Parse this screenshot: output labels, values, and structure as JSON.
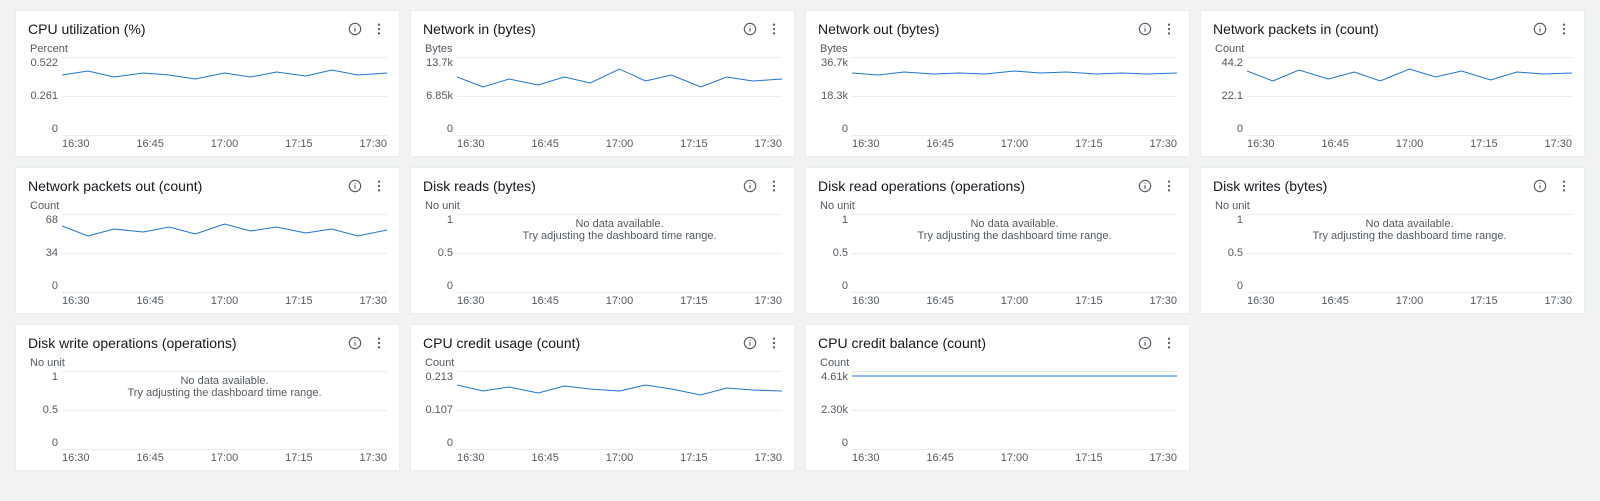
{
  "xTicks": [
    "16:30",
    "16:45",
    "17:00",
    "17:15",
    "17:30"
  ],
  "noData": {
    "line1": "No data available.",
    "line2": "Try adjusting the dashboard time range."
  },
  "lineColor": "#2074d5",
  "widgets": [
    {
      "title": "CPU utilization (%)",
      "unit": "Percent",
      "yTicks": [
        "0.522",
        "0.261",
        "0"
      ],
      "series": "wavy",
      "hasData": true
    },
    {
      "title": "Network in (bytes)",
      "unit": "Bytes",
      "yTicks": [
        "13.7k",
        "6.85k",
        "0"
      ],
      "series": "wavy2",
      "hasData": true
    },
    {
      "title": "Network out (bytes)",
      "unit": "Bytes",
      "yTicks": [
        "36.7k",
        "18.3k",
        "0"
      ],
      "series": "smooth",
      "hasData": true
    },
    {
      "title": "Network packets in (count)",
      "unit": "Count",
      "yTicks": [
        "44.2",
        "22.1",
        "0"
      ],
      "series": "wavy3",
      "hasData": true
    },
    {
      "title": "Network packets out (count)",
      "unit": "Count",
      "yTicks": [
        "68",
        "34",
        "0"
      ],
      "series": "wavy4",
      "hasData": true
    },
    {
      "title": "Disk reads (bytes)",
      "unit": "No unit",
      "yTicks": [
        "1",
        "0.5",
        "0"
      ],
      "series": "",
      "hasData": false
    },
    {
      "title": "Disk read operations (operations)",
      "unit": "No unit",
      "yTicks": [
        "1",
        "0.5",
        "0"
      ],
      "series": "",
      "hasData": false
    },
    {
      "title": "Disk writes (bytes)",
      "unit": "No unit",
      "yTicks": [
        "1",
        "0.5",
        "0"
      ],
      "series": "",
      "hasData": false
    },
    {
      "title": "Disk write operations (operations)",
      "unit": "No unit",
      "yTicks": [
        "1",
        "0.5",
        "0"
      ],
      "series": "",
      "hasData": false
    },
    {
      "title": "CPU credit usage (count)",
      "unit": "Count",
      "yTicks": [
        "0.213",
        "0.107",
        "0"
      ],
      "series": "wavy5",
      "hasData": true
    },
    {
      "title": "CPU credit balance (count)",
      "unit": "Count",
      "yTicks": [
        "4.61k",
        "2.30k",
        "0"
      ],
      "series": "flat",
      "hasData": true
    }
  ],
  "chart_data": [
    {
      "type": "line",
      "title": "CPU utilization (%)",
      "xlabel": "",
      "ylabel": "Percent",
      "ylim": [
        0,
        0.522
      ],
      "x": [
        "16:30",
        "16:35",
        "16:40",
        "16:45",
        "16:50",
        "16:55",
        "17:00",
        "17:05",
        "17:10",
        "17:15",
        "17:20",
        "17:25",
        "17:30"
      ],
      "values": [
        0.42,
        0.46,
        0.4,
        0.45,
        0.43,
        0.41,
        0.44,
        0.47,
        0.42,
        0.45,
        0.44,
        0.46,
        0.45
      ]
    },
    {
      "type": "line",
      "title": "Network in (bytes)",
      "xlabel": "",
      "ylabel": "Bytes",
      "ylim": [
        0,
        13700
      ],
      "x": [
        "16:30",
        "16:35",
        "16:40",
        "16:45",
        "16:50",
        "16:55",
        "17:00",
        "17:05",
        "17:10",
        "17:15",
        "17:20",
        "17:25",
        "17:30"
      ],
      "values": [
        11000,
        9500,
        12000,
        10500,
        11500,
        10000,
        13700,
        10800,
        12200,
        9800,
        11800,
        11000,
        11500
      ]
    },
    {
      "type": "line",
      "title": "Network out (bytes)",
      "xlabel": "",
      "ylabel": "Bytes",
      "ylim": [
        0,
        36700
      ],
      "x": [
        "16:30",
        "16:35",
        "16:40",
        "16:45",
        "16:50",
        "16:55",
        "17:00",
        "17:05",
        "17:10",
        "17:15",
        "17:20",
        "17:25",
        "17:30"
      ],
      "values": [
        30000,
        29500,
        31000,
        30500,
        30200,
        30800,
        32000,
        31200,
        31500,
        30800,
        31200,
        30900,
        31000
      ]
    },
    {
      "type": "line",
      "title": "Network packets in (count)",
      "xlabel": "",
      "ylabel": "Count",
      "ylim": [
        0,
        44.2
      ],
      "x": [
        "16:30",
        "16:35",
        "16:40",
        "16:45",
        "16:50",
        "16:55",
        "17:00",
        "17:05",
        "17:10",
        "17:15",
        "17:20",
        "17:25",
        "17:30"
      ],
      "values": [
        38,
        34,
        40,
        36,
        39,
        35,
        41,
        37,
        40,
        36,
        39,
        38,
        39
      ]
    },
    {
      "type": "line",
      "title": "Network packets out (count)",
      "xlabel": "",
      "ylabel": "Count",
      "ylim": [
        0,
        68
      ],
      "x": [
        "16:30",
        "16:35",
        "16:40",
        "16:45",
        "16:50",
        "16:55",
        "17:00",
        "17:05",
        "17:10",
        "17:15",
        "17:20",
        "17:25",
        "17:30"
      ],
      "values": [
        62,
        55,
        60,
        58,
        62,
        57,
        66,
        60,
        62,
        58,
        60,
        56,
        60
      ]
    },
    {
      "type": "line",
      "title": "Disk reads (bytes)",
      "xlabel": "",
      "ylabel": "No unit",
      "ylim": [
        0,
        1
      ],
      "values": [],
      "note": "No data available."
    },
    {
      "type": "line",
      "title": "Disk read operations (operations)",
      "xlabel": "",
      "ylabel": "No unit",
      "ylim": [
        0,
        1
      ],
      "values": [],
      "note": "No data available."
    },
    {
      "type": "line",
      "title": "Disk writes (bytes)",
      "xlabel": "",
      "ylabel": "No unit",
      "ylim": [
        0,
        1
      ],
      "values": [],
      "note": "No data available."
    },
    {
      "type": "line",
      "title": "Disk write operations (operations)",
      "xlabel": "",
      "ylabel": "No unit",
      "ylim": [
        0,
        1
      ],
      "values": [],
      "note": "No data available."
    },
    {
      "type": "line",
      "title": "CPU credit usage (count)",
      "xlabel": "",
      "ylabel": "Count",
      "ylim": [
        0,
        0.213
      ],
      "x": [
        "16:30",
        "16:35",
        "16:40",
        "16:45",
        "16:50",
        "16:55",
        "17:00",
        "17:05",
        "17:10",
        "17:15",
        "17:20",
        "17:25",
        "17:30"
      ],
      "values": [
        0.19,
        0.17,
        0.18,
        0.17,
        0.19,
        0.18,
        0.17,
        0.19,
        0.18,
        0.16,
        0.18,
        0.17,
        0.17
      ]
    },
    {
      "type": "line",
      "title": "CPU credit balance (count)",
      "xlabel": "",
      "ylabel": "Count",
      "ylim": [
        0,
        4610
      ],
      "x": [
        "16:30",
        "16:35",
        "16:40",
        "16:45",
        "16:50",
        "16:55",
        "17:00",
        "17:05",
        "17:10",
        "17:15",
        "17:20",
        "17:25",
        "17:30"
      ],
      "values": [
        4610,
        4610,
        4610,
        4610,
        4610,
        4610,
        4610,
        4610,
        4610,
        4610,
        4610,
        4610,
        4610
      ]
    }
  ]
}
